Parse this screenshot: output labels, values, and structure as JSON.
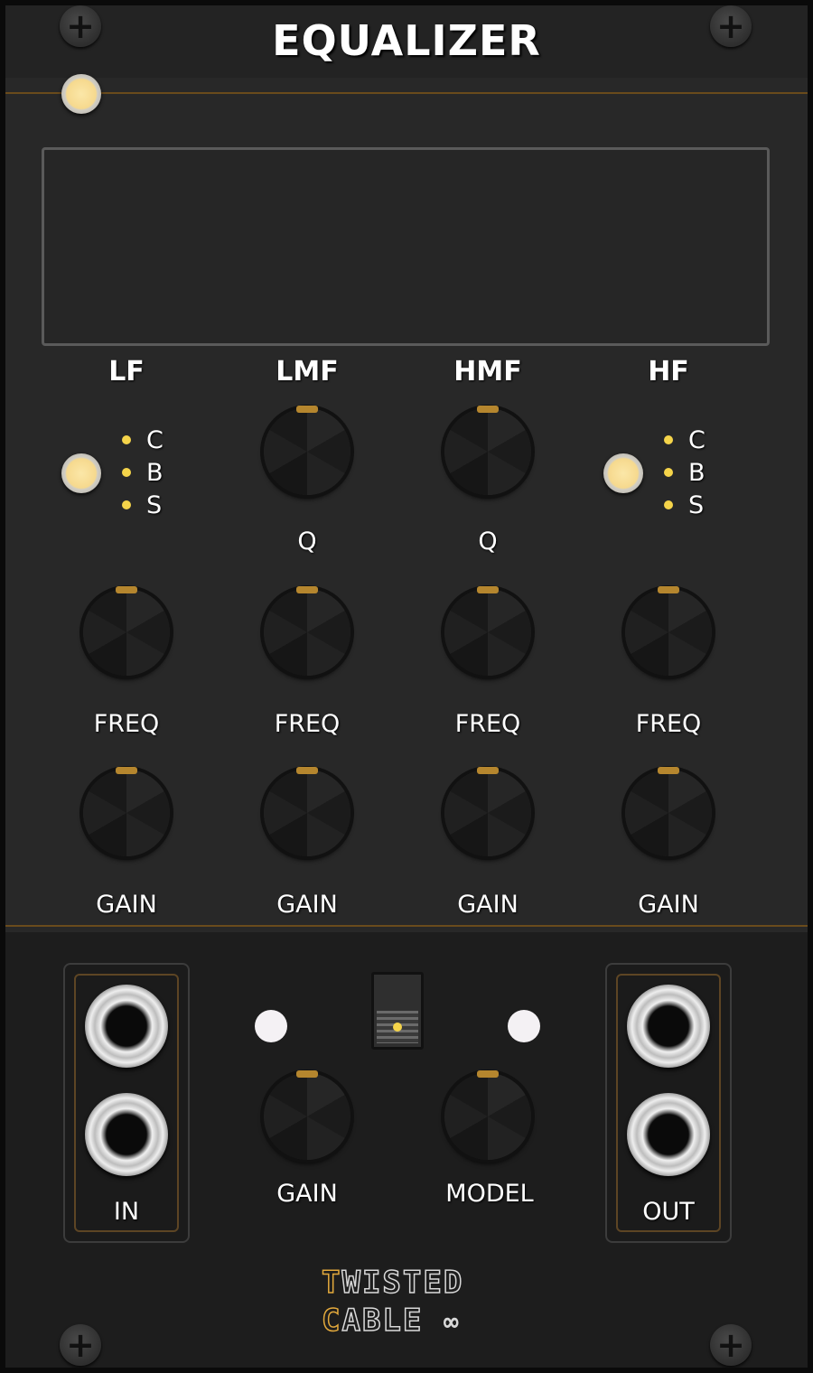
{
  "module": {
    "title": "EQUALIZER",
    "accent_color": "#e3a93c",
    "knob_marker_color": "#b5862e",
    "led_color": "#f6d98e",
    "mode_dot_color": "#f5d44a"
  },
  "bands": [
    {
      "label": "LF",
      "modes": [
        "C",
        "B",
        "S"
      ],
      "freq_label": "FREQ",
      "gain_label": "GAIN"
    },
    {
      "label": "LMF",
      "q_label": "Q",
      "freq_label": "FREQ",
      "gain_label": "GAIN"
    },
    {
      "label": "HMF",
      "q_label": "Q",
      "freq_label": "FREQ",
      "gain_label": "GAIN"
    },
    {
      "label": "HF",
      "modes": [
        "C",
        "B",
        "S"
      ],
      "freq_label": "FREQ",
      "gain_label": "GAIN"
    }
  ],
  "io": {
    "in_label": "IN",
    "out_label": "OUT",
    "gain_label": "GAIN",
    "model_label": "MODEL"
  },
  "brand": {
    "line1_first": "T",
    "line1_rest": "WISTED",
    "line2_first": "C",
    "line2_rest": "ABLE",
    "symbol": "∞"
  },
  "icons": {
    "screw": "plus-screw-icon",
    "infinity": "infinity-icon"
  }
}
